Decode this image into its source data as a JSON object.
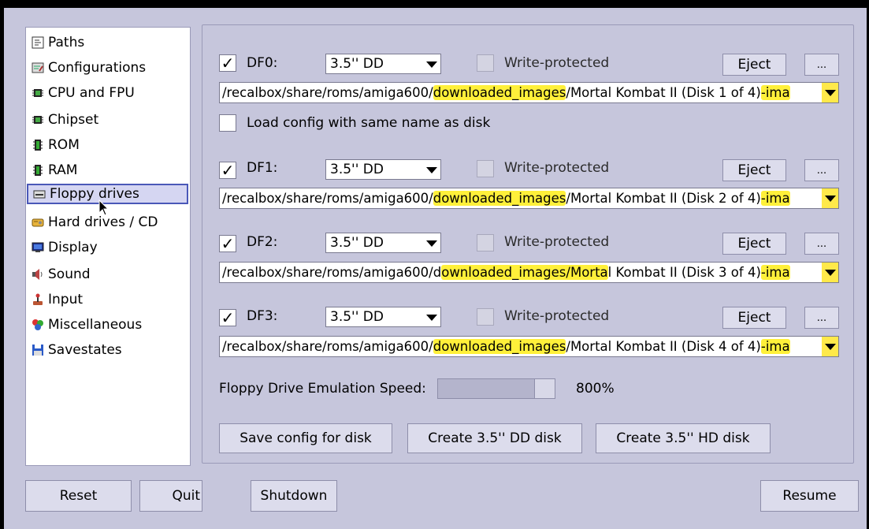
{
  "sidebar": {
    "items": [
      {
        "label": "Paths",
        "icon": "paths-icon"
      },
      {
        "label": "Configurations",
        "icon": "configurations-icon"
      },
      {
        "label": "CPU and FPU",
        "icon": "chip-icon"
      },
      {
        "label": "Chipset",
        "icon": "chip-icon"
      },
      {
        "label": "ROM",
        "icon": "memory-icon"
      },
      {
        "label": "RAM",
        "icon": "memory-icon"
      },
      {
        "label": "Floppy drives",
        "icon": "floppy-drive-icon"
      },
      {
        "label": "Hard drives / CD",
        "icon": "hard-drive-icon"
      },
      {
        "label": "Display",
        "icon": "display-icon"
      },
      {
        "label": "Sound",
        "icon": "sound-icon"
      },
      {
        "label": "Input",
        "icon": "joystick-icon"
      },
      {
        "label": "Miscellaneous",
        "icon": "puzzle-icon"
      },
      {
        "label": "Savestates",
        "icon": "save-icon"
      }
    ],
    "selected": "Floppy drives"
  },
  "drives": [
    {
      "label": "DF0:",
      "enabled": true,
      "type": "3.5'' DD",
      "write_protected_label": "Write-protected",
      "eject_label": "Eject",
      "browse_label": "...",
      "path_prefix": "/recalbox/share/roms/amiga600/",
      "path_hl": "downloaded_images",
      "path_rest": "/Mortal Kombat II (Disk 1 of 4)",
      "path_tail": "-ima"
    },
    {
      "label": "DF1:",
      "enabled": true,
      "type": "3.5'' DD",
      "write_protected_label": "Write-protected",
      "eject_label": "Eject",
      "browse_label": "...",
      "path_prefix": "/recalbox/share/roms/amiga600/",
      "path_hl": "downloaded_images",
      "path_rest": "/Mortal Kombat II (Disk 2 of 4)",
      "path_tail": "-ima"
    },
    {
      "label": "DF2:",
      "enabled": true,
      "type": "3.5'' DD",
      "write_protected_label": "Write-protected",
      "eject_label": "Eject",
      "browse_label": "...",
      "path_prefix": "/recalbox/share/roms/amiga600/d",
      "path_hl": "ownloaded_images/Morta",
      "path_rest": "l Kombat II (Disk 3 of 4)",
      "path_tail": "-ima"
    },
    {
      "label": "DF3:",
      "enabled": true,
      "type": "3.5'' DD",
      "write_protected_label": "Write-protected",
      "eject_label": "Eject",
      "browse_label": "...",
      "path_prefix": "/recalbox/share/roms/amiga600/",
      "path_hl": "downloaded_images",
      "path_rest": "/Mortal Kombat II (Disk 4 of 4)",
      "path_tail": "-ima"
    }
  ],
  "load_config_label": "Load config with same name as disk",
  "speed": {
    "label": "Floppy Drive Emulation Speed:",
    "value_text": "800%",
    "level": 0.83
  },
  "actions": {
    "save_config": "Save config for disk",
    "create_dd": "Create 3.5'' DD disk",
    "create_hd": "Create 3.5'' HD disk"
  },
  "footer": {
    "reset": "Reset",
    "quit": "Quit",
    "shutdown": "Shutdown",
    "resume": "Resume"
  },
  "colors": {
    "background": "#c6c6dc",
    "highlight": "#fff03a",
    "selection_border": "#4a58b8"
  }
}
